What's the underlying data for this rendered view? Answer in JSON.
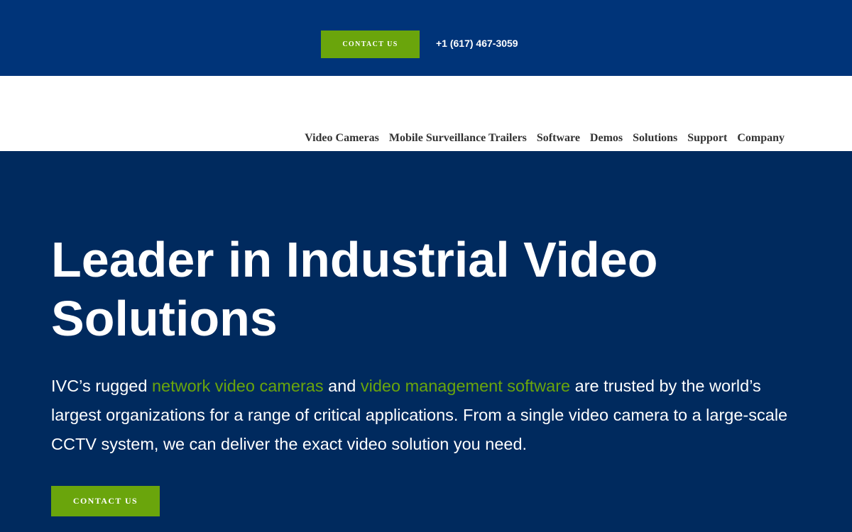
{
  "colors": {
    "topbar_bg": "#003479",
    "hero_bg": "#002a5e",
    "accent_green": "#6aa50c",
    "nav_text": "#333333",
    "text_light": "#ffffff"
  },
  "topbar": {
    "contact_label": "Contact Us",
    "phone": "+1 (617) 467-3059"
  },
  "nav": {
    "items": [
      "Video Cameras",
      "Mobile Surveillance Trailers",
      "Software",
      "Demos",
      "Solutions",
      "Support",
      "Company"
    ]
  },
  "hero": {
    "title": "Leader in Industrial Video Solutions",
    "intro_prefix": "IVC’s rugged ",
    "link_cameras": "network video cameras",
    "intro_and": " and ",
    "link_software": "video management software",
    "intro_rest": " are trusted by the world’s largest organizations for a range of critical applications. From a single video camera to a large-scale CCTV system, we can deliver the exact video solution you need.",
    "contact_label": "Contact Us"
  }
}
